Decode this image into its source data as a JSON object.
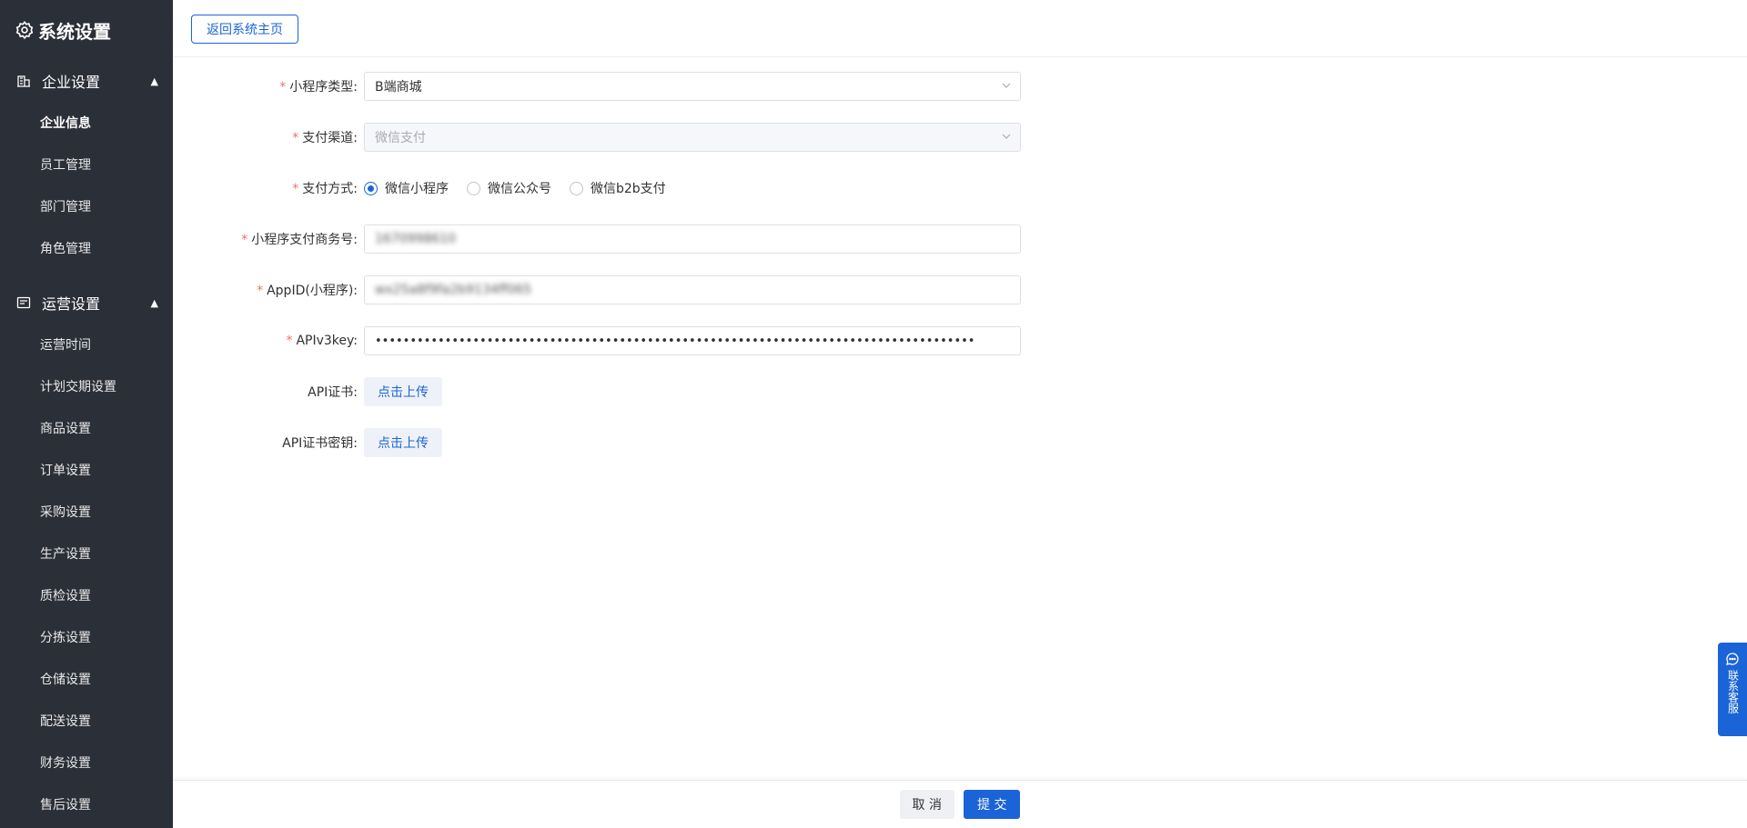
{
  "sidebar": {
    "title": "系统设置",
    "groups": [
      {
        "label": "企业设置",
        "items": [
          "企业信息",
          "员工管理",
          "部门管理",
          "角色管理"
        ]
      },
      {
        "label": "运营设置",
        "items": [
          "运营时间",
          "计划交期设置",
          "商品设置",
          "订单设置",
          "采购设置",
          "生产设置",
          "质检设置",
          "分拣设置",
          "仓储设置",
          "配送设置",
          "财务设置",
          "售后设置"
        ]
      }
    ],
    "active_item": "企业信息"
  },
  "topbar": {
    "back_label": "返回系统主页"
  },
  "form": {
    "mini_program_type": {
      "label": "小程序类型:",
      "value": "B端商城"
    },
    "pay_channel": {
      "label": "支付渠道:",
      "value": "微信支付"
    },
    "pay_method": {
      "label": "支付方式:",
      "options": [
        "微信小程序",
        "微信公众号",
        "微信b2b支付"
      ],
      "selected": "微信小程序"
    },
    "merchant_id": {
      "label": "小程序支付商务号:",
      "value": "1670998610"
    },
    "app_id": {
      "label": "AppID(小程序):",
      "value": "wx25a8f9fa2b9134ff065"
    },
    "api_v3_key": {
      "label": "APIv3key:",
      "value": "••••••••••••••••••••••••••••••••••••••••••••••••••••••••••••••••••••••••••••••••••••••"
    },
    "api_cert": {
      "label": "API证书:",
      "button": "点击上传"
    },
    "api_cert_key": {
      "label": "API证书密钥:",
      "button": "点击上传"
    }
  },
  "footer": {
    "cancel": "取 消",
    "submit": "提 交"
  },
  "service": {
    "label": "联系客服"
  },
  "colors": {
    "primary": "#1b64d8",
    "sidebar_bg": "#2b2f38",
    "required": "#f56c6c"
  }
}
